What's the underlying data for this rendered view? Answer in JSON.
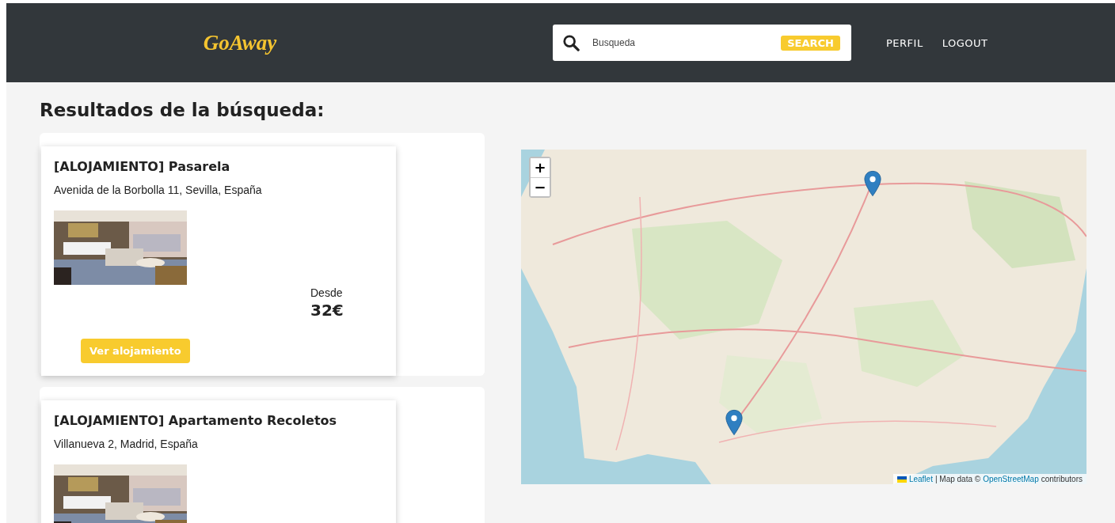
{
  "brand": "GoAway",
  "search": {
    "placeholder": "Busqueda",
    "button": "SEARCH"
  },
  "nav": [
    "PERFIL",
    "LOGOUT"
  ],
  "heading": "Resultados de la búsqueda:",
  "results": [
    {
      "title": "[ALOJAMIENTO] Pasarela",
      "address": "Avenida de la Borbolla 11, Sevilla, España",
      "price_label": "Desde",
      "price": "32€",
      "button": "Ver alojamiento"
    },
    {
      "title": "[ALOJAMIENTO] Apartamento Recoletos",
      "address": "Villanueva 2, Madrid, España"
    }
  ],
  "map": {
    "zoom_in": "+",
    "zoom_out": "−",
    "attribution": {
      "link": "Leaflet",
      "text": "| Map data ©",
      "source": "OpenStreetMap",
      "suffix": "contributors"
    }
  }
}
